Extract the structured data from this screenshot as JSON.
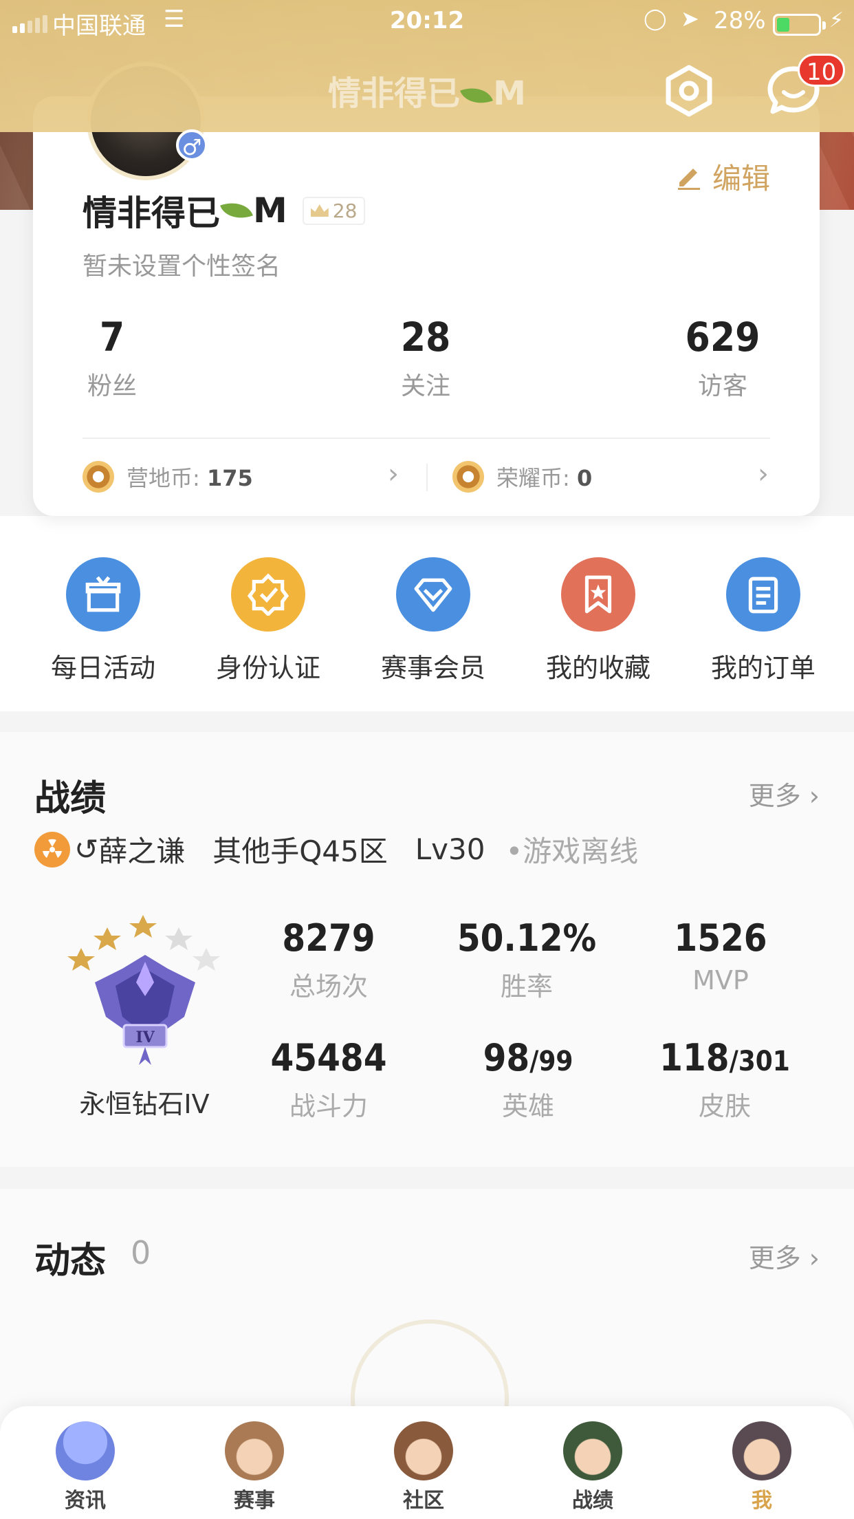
{
  "status_bar": {
    "carrier": "中国联通",
    "time": "20:12",
    "battery": "28%"
  },
  "header": {
    "title": "情非得已",
    "title_suffix": "M",
    "badge_count": "10"
  },
  "profile": {
    "name": "情非得已",
    "name_suffix": "M",
    "level": "28",
    "gender_symbol": "♂",
    "edit_label": "编辑",
    "signature": "暂未设置个性签名",
    "stats": [
      {
        "value": "7",
        "label": "粉丝"
      },
      {
        "value": "28",
        "label": "关注"
      },
      {
        "value": "629",
        "label": "访客"
      }
    ],
    "coins": [
      {
        "label": "营地币:",
        "value": "175"
      },
      {
        "label": "荣耀币:",
        "value": "0"
      }
    ]
  },
  "quick_menu": [
    {
      "label": "每日活动",
      "icon": "gift-icon",
      "color": "#4a8fe0"
    },
    {
      "label": "身份认证",
      "icon": "badge-check-icon",
      "color": "#f3b43c"
    },
    {
      "label": "赛事会员",
      "icon": "diamond-icon",
      "color": "#4a8fe0"
    },
    {
      "label": "我的收藏",
      "icon": "bookmark-icon",
      "color": "#e2715a"
    },
    {
      "label": "我的订单",
      "icon": "clipboard-icon",
      "color": "#4a8fe0"
    }
  ],
  "record": {
    "title": "战绩",
    "more": "更多",
    "player": "薛之谦",
    "server": "其他手Q45区",
    "level": "Lv30",
    "status": "•游戏离线",
    "rank": "永恒钻石IV",
    "rank_numeral": "IV",
    "stats": [
      {
        "value": "8279",
        "label": "总场次"
      },
      {
        "value": "50.12%",
        "label": "胜率"
      },
      {
        "value": "1526",
        "label": "MVP"
      },
      {
        "value": "45484",
        "label": "战斗力"
      },
      {
        "value": "98",
        "value_total": "/99",
        "label": "英雄"
      },
      {
        "value": "118",
        "value_total": "/301",
        "label": "皮肤"
      }
    ]
  },
  "activity": {
    "title": "动态",
    "count": "0",
    "more": "更多"
  },
  "tabs": [
    {
      "label": "资讯",
      "color": "#7b8fe6"
    },
    {
      "label": "赛事",
      "color": "#a97a54"
    },
    {
      "label": "社区",
      "color": "#8a5a3c"
    },
    {
      "label": "战绩",
      "color": "#3e7a3a"
    },
    {
      "label": "我",
      "color": "#5a4a52",
      "active": true
    }
  ],
  "colors": {
    "accent": "#d9a34c",
    "header": "#e3c687",
    "badge": "#e8372c"
  }
}
